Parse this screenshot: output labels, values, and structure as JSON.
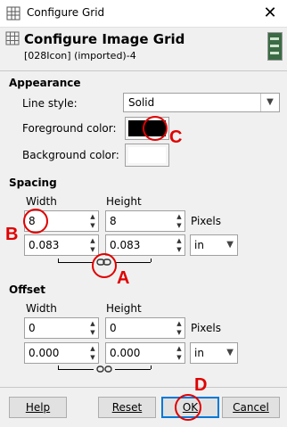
{
  "window": {
    "title": "Configure Grid",
    "close_icon": "✕"
  },
  "header": {
    "title": "Configure Image Grid",
    "subtitle": "[028Icon] (imported)-4"
  },
  "appearance": {
    "section_title": "Appearance",
    "line_style_label": "Line style:",
    "line_style_value": "Solid",
    "foreground_label": "Foreground color:",
    "foreground_color": "#000000",
    "background_label": "Background color:",
    "background_color": "#ffffff"
  },
  "spacing": {
    "section_title": "Spacing",
    "width_label": "Width",
    "height_label": "Height",
    "width_pixels": "8",
    "height_pixels": "8",
    "pixels_label": "Pixels",
    "width_in": "0.083",
    "height_in": "0.083",
    "unit": "in",
    "chained": true
  },
  "offset": {
    "section_title": "Offset",
    "width_label": "Width",
    "height_label": "Height",
    "width_pixels": "0",
    "height_pixels": "0",
    "pixels_label": "Pixels",
    "width_in": "0.000",
    "height_in": "0.000",
    "unit": "in",
    "chained": false
  },
  "buttons": {
    "help": "Help",
    "reset": "Reset",
    "ok": "OK",
    "cancel": "Cancel"
  },
  "annotations": {
    "a": "A",
    "b": "B",
    "c": "C",
    "d": "D",
    "color": "#e00000"
  }
}
